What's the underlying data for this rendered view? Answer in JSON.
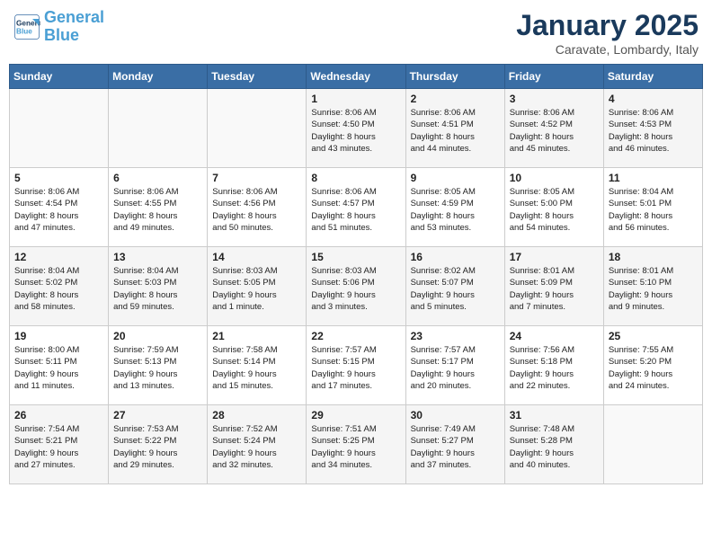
{
  "header": {
    "logo_line1": "General",
    "logo_line2": "Blue",
    "month": "January 2025",
    "location": "Caravate, Lombardy, Italy"
  },
  "weekdays": [
    "Sunday",
    "Monday",
    "Tuesday",
    "Wednesday",
    "Thursday",
    "Friday",
    "Saturday"
  ],
  "weeks": [
    [
      {
        "day": "",
        "info": ""
      },
      {
        "day": "",
        "info": ""
      },
      {
        "day": "",
        "info": ""
      },
      {
        "day": "1",
        "info": "Sunrise: 8:06 AM\nSunset: 4:50 PM\nDaylight: 8 hours\nand 43 minutes."
      },
      {
        "day": "2",
        "info": "Sunrise: 8:06 AM\nSunset: 4:51 PM\nDaylight: 8 hours\nand 44 minutes."
      },
      {
        "day": "3",
        "info": "Sunrise: 8:06 AM\nSunset: 4:52 PM\nDaylight: 8 hours\nand 45 minutes."
      },
      {
        "day": "4",
        "info": "Sunrise: 8:06 AM\nSunset: 4:53 PM\nDaylight: 8 hours\nand 46 minutes."
      }
    ],
    [
      {
        "day": "5",
        "info": "Sunrise: 8:06 AM\nSunset: 4:54 PM\nDaylight: 8 hours\nand 47 minutes."
      },
      {
        "day": "6",
        "info": "Sunrise: 8:06 AM\nSunset: 4:55 PM\nDaylight: 8 hours\nand 49 minutes."
      },
      {
        "day": "7",
        "info": "Sunrise: 8:06 AM\nSunset: 4:56 PM\nDaylight: 8 hours\nand 50 minutes."
      },
      {
        "day": "8",
        "info": "Sunrise: 8:06 AM\nSunset: 4:57 PM\nDaylight: 8 hours\nand 51 minutes."
      },
      {
        "day": "9",
        "info": "Sunrise: 8:05 AM\nSunset: 4:59 PM\nDaylight: 8 hours\nand 53 minutes."
      },
      {
        "day": "10",
        "info": "Sunrise: 8:05 AM\nSunset: 5:00 PM\nDaylight: 8 hours\nand 54 minutes."
      },
      {
        "day": "11",
        "info": "Sunrise: 8:04 AM\nSunset: 5:01 PM\nDaylight: 8 hours\nand 56 minutes."
      }
    ],
    [
      {
        "day": "12",
        "info": "Sunrise: 8:04 AM\nSunset: 5:02 PM\nDaylight: 8 hours\nand 58 minutes."
      },
      {
        "day": "13",
        "info": "Sunrise: 8:04 AM\nSunset: 5:03 PM\nDaylight: 8 hours\nand 59 minutes."
      },
      {
        "day": "14",
        "info": "Sunrise: 8:03 AM\nSunset: 5:05 PM\nDaylight: 9 hours\nand 1 minute."
      },
      {
        "day": "15",
        "info": "Sunrise: 8:03 AM\nSunset: 5:06 PM\nDaylight: 9 hours\nand 3 minutes."
      },
      {
        "day": "16",
        "info": "Sunrise: 8:02 AM\nSunset: 5:07 PM\nDaylight: 9 hours\nand 5 minutes."
      },
      {
        "day": "17",
        "info": "Sunrise: 8:01 AM\nSunset: 5:09 PM\nDaylight: 9 hours\nand 7 minutes."
      },
      {
        "day": "18",
        "info": "Sunrise: 8:01 AM\nSunset: 5:10 PM\nDaylight: 9 hours\nand 9 minutes."
      }
    ],
    [
      {
        "day": "19",
        "info": "Sunrise: 8:00 AM\nSunset: 5:11 PM\nDaylight: 9 hours\nand 11 minutes."
      },
      {
        "day": "20",
        "info": "Sunrise: 7:59 AM\nSunset: 5:13 PM\nDaylight: 9 hours\nand 13 minutes."
      },
      {
        "day": "21",
        "info": "Sunrise: 7:58 AM\nSunset: 5:14 PM\nDaylight: 9 hours\nand 15 minutes."
      },
      {
        "day": "22",
        "info": "Sunrise: 7:57 AM\nSunset: 5:15 PM\nDaylight: 9 hours\nand 17 minutes."
      },
      {
        "day": "23",
        "info": "Sunrise: 7:57 AM\nSunset: 5:17 PM\nDaylight: 9 hours\nand 20 minutes."
      },
      {
        "day": "24",
        "info": "Sunrise: 7:56 AM\nSunset: 5:18 PM\nDaylight: 9 hours\nand 22 minutes."
      },
      {
        "day": "25",
        "info": "Sunrise: 7:55 AM\nSunset: 5:20 PM\nDaylight: 9 hours\nand 24 minutes."
      }
    ],
    [
      {
        "day": "26",
        "info": "Sunrise: 7:54 AM\nSunset: 5:21 PM\nDaylight: 9 hours\nand 27 minutes."
      },
      {
        "day": "27",
        "info": "Sunrise: 7:53 AM\nSunset: 5:22 PM\nDaylight: 9 hours\nand 29 minutes."
      },
      {
        "day": "28",
        "info": "Sunrise: 7:52 AM\nSunset: 5:24 PM\nDaylight: 9 hours\nand 32 minutes."
      },
      {
        "day": "29",
        "info": "Sunrise: 7:51 AM\nSunset: 5:25 PM\nDaylight: 9 hours\nand 34 minutes."
      },
      {
        "day": "30",
        "info": "Sunrise: 7:49 AM\nSunset: 5:27 PM\nDaylight: 9 hours\nand 37 minutes."
      },
      {
        "day": "31",
        "info": "Sunrise: 7:48 AM\nSunset: 5:28 PM\nDaylight: 9 hours\nand 40 minutes."
      },
      {
        "day": "",
        "info": ""
      }
    ]
  ]
}
